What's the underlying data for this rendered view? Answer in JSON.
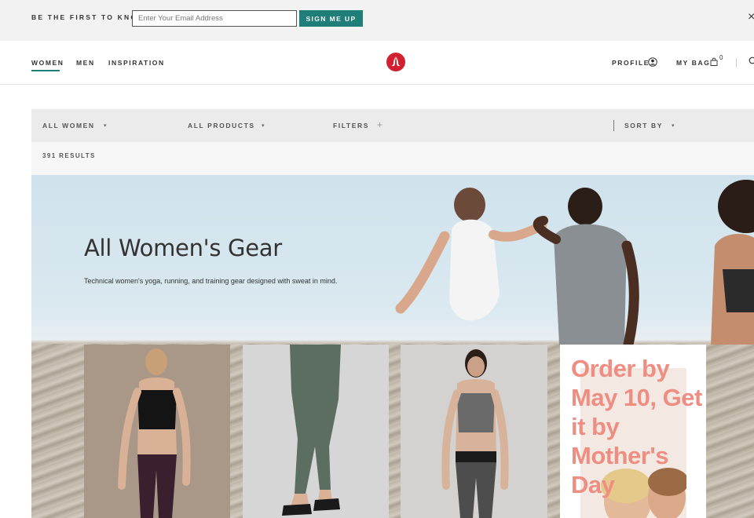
{
  "promo_bar": {
    "label": "BE THE FIRST TO KNOW",
    "email_placeholder": "Enter Your Email Address",
    "signup_label": "SIGN ME UP",
    "close_icon": "×"
  },
  "header": {
    "nav": [
      "WOMEN",
      "MEN",
      "INSPIRATION"
    ],
    "active_nav": "WOMEN",
    "profile_label": "PROFILE",
    "bag_label": "MY BAG",
    "bag_count": "0",
    "logo_icon": "lululemon-logo",
    "accent_color": "#1f7e77",
    "logo_color": "#d22030"
  },
  "filters": {
    "all_women": "ALL WOMEN",
    "all_products": "ALL PRODUCTS",
    "filters": "FILTERS",
    "sort_by": "SORT BY",
    "caret": "▾",
    "plus": "+"
  },
  "results": {
    "count_text": "391 RESULTS"
  },
  "hero": {
    "title": "All Women's Gear",
    "subtitle": "Technical women's yoga, running, and training gear designed with sweat in mind."
  },
  "promo_tile": {
    "text": "Order by May 10, Get it by Mother's Day",
    "text_color": "#ee8e83"
  }
}
